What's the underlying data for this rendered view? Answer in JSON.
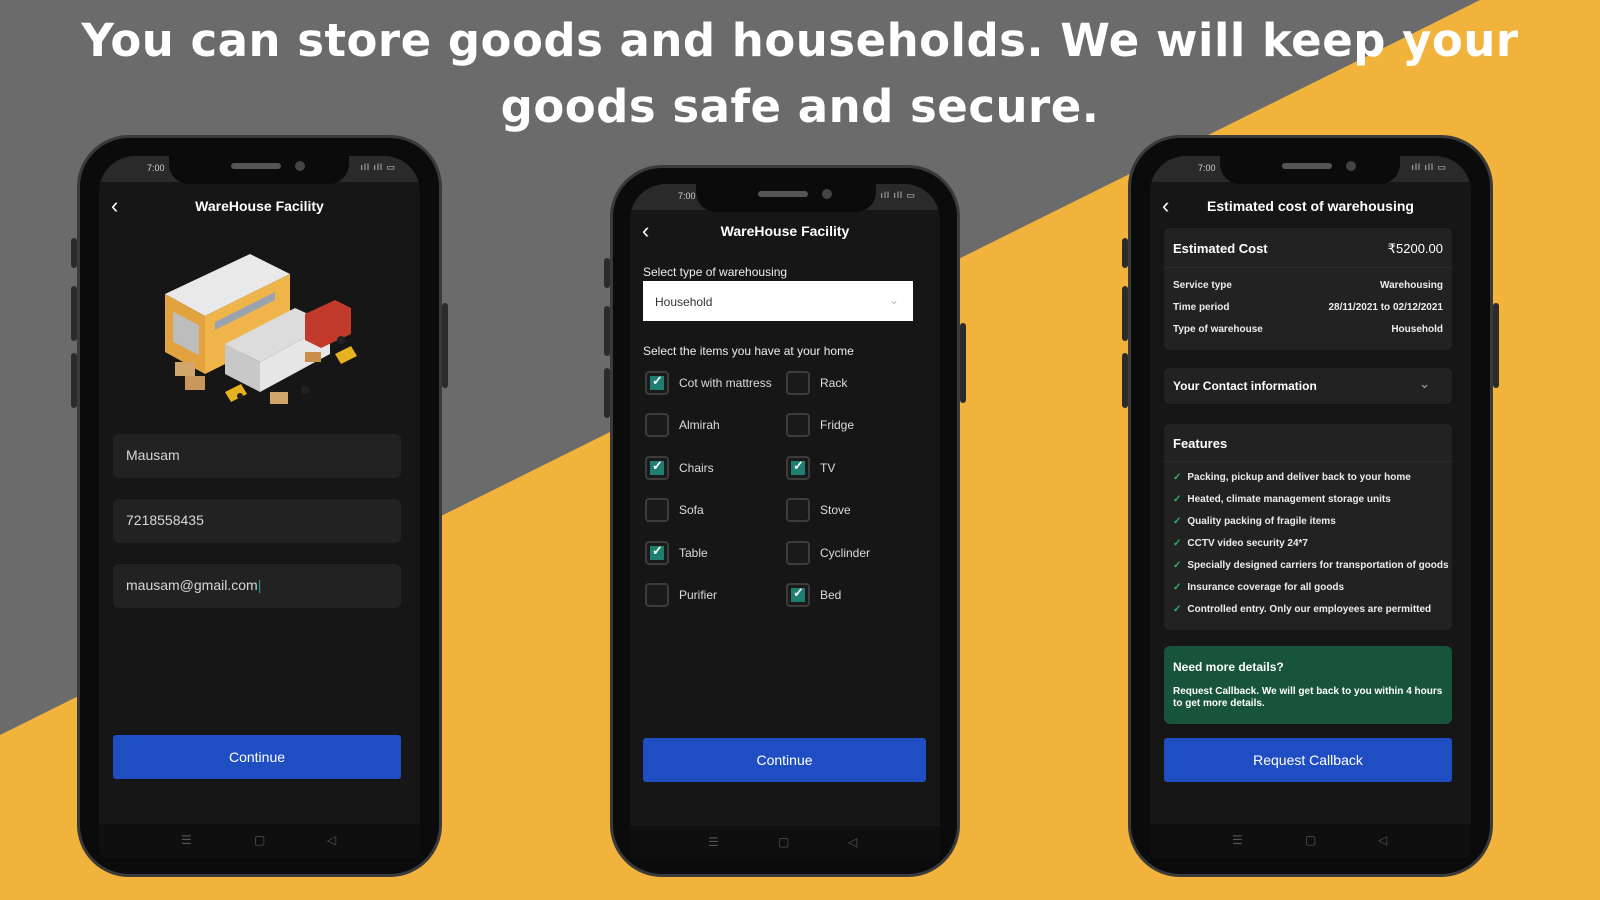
{
  "headline": "You can store goods and households. We will keep your goods safe and secure.",
  "colors": {
    "background_grey": "#6b6b6b",
    "background_orange": "#f2b33d",
    "accent_blue": "#1f4ec3",
    "check_teal": "#1e7f70",
    "callout_green": "#17543b"
  },
  "status_time": "7:00",
  "phone1": {
    "title": "WareHouse Facility",
    "illustration": "warehouse-illustration",
    "name_value": "Mausam",
    "phone_value": "7218558435",
    "email_value": "mausam@gmail.com",
    "continue_label": "Continue"
  },
  "phone2": {
    "title": "WareHouse Facility",
    "select_label": "Select type of warehousing",
    "select_value": "Household",
    "items_label": "Select the items you have at your home",
    "items": [
      {
        "label": "Cot with mattress",
        "checked": true
      },
      {
        "label": "Rack",
        "checked": false
      },
      {
        "label": "Almirah",
        "checked": false
      },
      {
        "label": "Fridge",
        "checked": false
      },
      {
        "label": "Chairs",
        "checked": true
      },
      {
        "label": "TV",
        "checked": true
      },
      {
        "label": "Sofa",
        "checked": false
      },
      {
        "label": "Stove",
        "checked": false
      },
      {
        "label": "Table",
        "checked": true
      },
      {
        "label": "Cyclinder",
        "checked": false
      },
      {
        "label": "Purifier",
        "checked": false
      },
      {
        "label": "Bed",
        "checked": true
      }
    ],
    "continue_label": "Continue"
  },
  "phone3": {
    "title": "Estimated cost of warehousing",
    "cost_label": "Estimated Cost",
    "cost_value": "₹5200.00",
    "details": [
      {
        "key": "Service type",
        "value": "Warehousing"
      },
      {
        "key": "Time period",
        "value": "28/11/2021 to 02/12/2021"
      },
      {
        "key": "Type of warehouse",
        "value": "Household"
      }
    ],
    "contact_label": "Your Contact  information",
    "features_title": "Features",
    "features": [
      "Packing, pickup and deliver back to your home",
      "Heated, climate management storage units",
      "Quality packing of fragile items",
      "CCTV video security 24*7",
      "Specially designed carriers for transportation of goods",
      "Insurance coverage for all goods",
      "Controlled entry. Only our employees are permitted"
    ],
    "callout_title": "Need more details?",
    "callout_text": "Request Callback. We will get back to you within 4 hours to get more details.",
    "callback_label": "Request Callback"
  }
}
